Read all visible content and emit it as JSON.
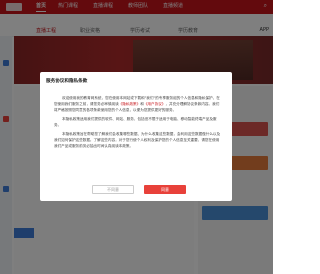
{
  "topnav": {
    "items": [
      "首页",
      "热门课程",
      "直播课程",
      "教师团队",
      "直播频道"
    ],
    "active_index": 0,
    "bg_color": "#c7141a"
  },
  "subnav": {
    "items": [
      "直播工程",
      "职业资格",
      "学历考试",
      "学历教育"
    ],
    "app_label": "APP"
  },
  "dialog": {
    "title": "服务协议和隐私条款",
    "p1_a": "欢迎使用我的教育网系统，您在使用本网站或下载和\"我们\"的专享服务组的个人信息和隐私保护，在您使用我们服务之前，请您务必审慎阅读",
    "p1_link1": "《隐私政策》",
    "p1_b": "和",
    "p1_link2": "《用户协议》",
    "p1_c": "，并充分理解协议条款内容。我们将严格按照您同意的各项条款使用您的个人信息，以便为您提供更好的服务。",
    "p2": "本隐私政策适用我们提供的软件、网站、服务，包括但不限于适用于电脑、移动智能终端产品及服务。",
    "p3": "本隐私政策旨在帮助您了解我们会收集哪些数据、为什么收集这些数据，会利用这些数据做什么以及我们如何保护这些数据。了解这些内容，对于您行使个人权利及保护您的个人信息至关重要，请您在使用我们产品或服务前务必抽出时间认真阅读本政策。",
    "disagree_label": "不同意",
    "agree_label": "同意"
  },
  "colors": {
    "accent": "#c7141a",
    "agree_button": "#e8413a",
    "overlay": "rgba(0,0,0,0.5)"
  }
}
